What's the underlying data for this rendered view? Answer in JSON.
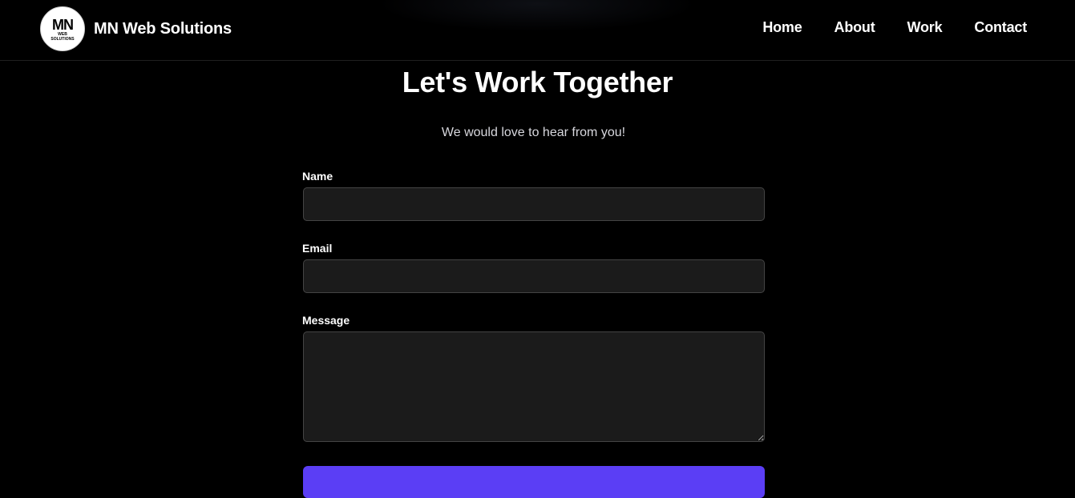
{
  "header": {
    "brand_name": "MN Web Solutions",
    "logo_text": "MN",
    "logo_subtext": "WEB SOLUTIONS",
    "nav": [
      {
        "label": "Home"
      },
      {
        "label": "About"
      },
      {
        "label": "Work"
      },
      {
        "label": "Contact"
      }
    ]
  },
  "contact": {
    "title": "Let's Work Together",
    "subtitle": "We would love to hear from you!",
    "fields": {
      "name": {
        "label": "Name",
        "value": ""
      },
      "email": {
        "label": "Email",
        "value": ""
      },
      "message": {
        "label": "Message",
        "value": ""
      }
    },
    "submit_label": ""
  },
  "colors": {
    "background": "#000000",
    "input_background": "#1b1b1b",
    "accent": "#5b3ef5"
  }
}
